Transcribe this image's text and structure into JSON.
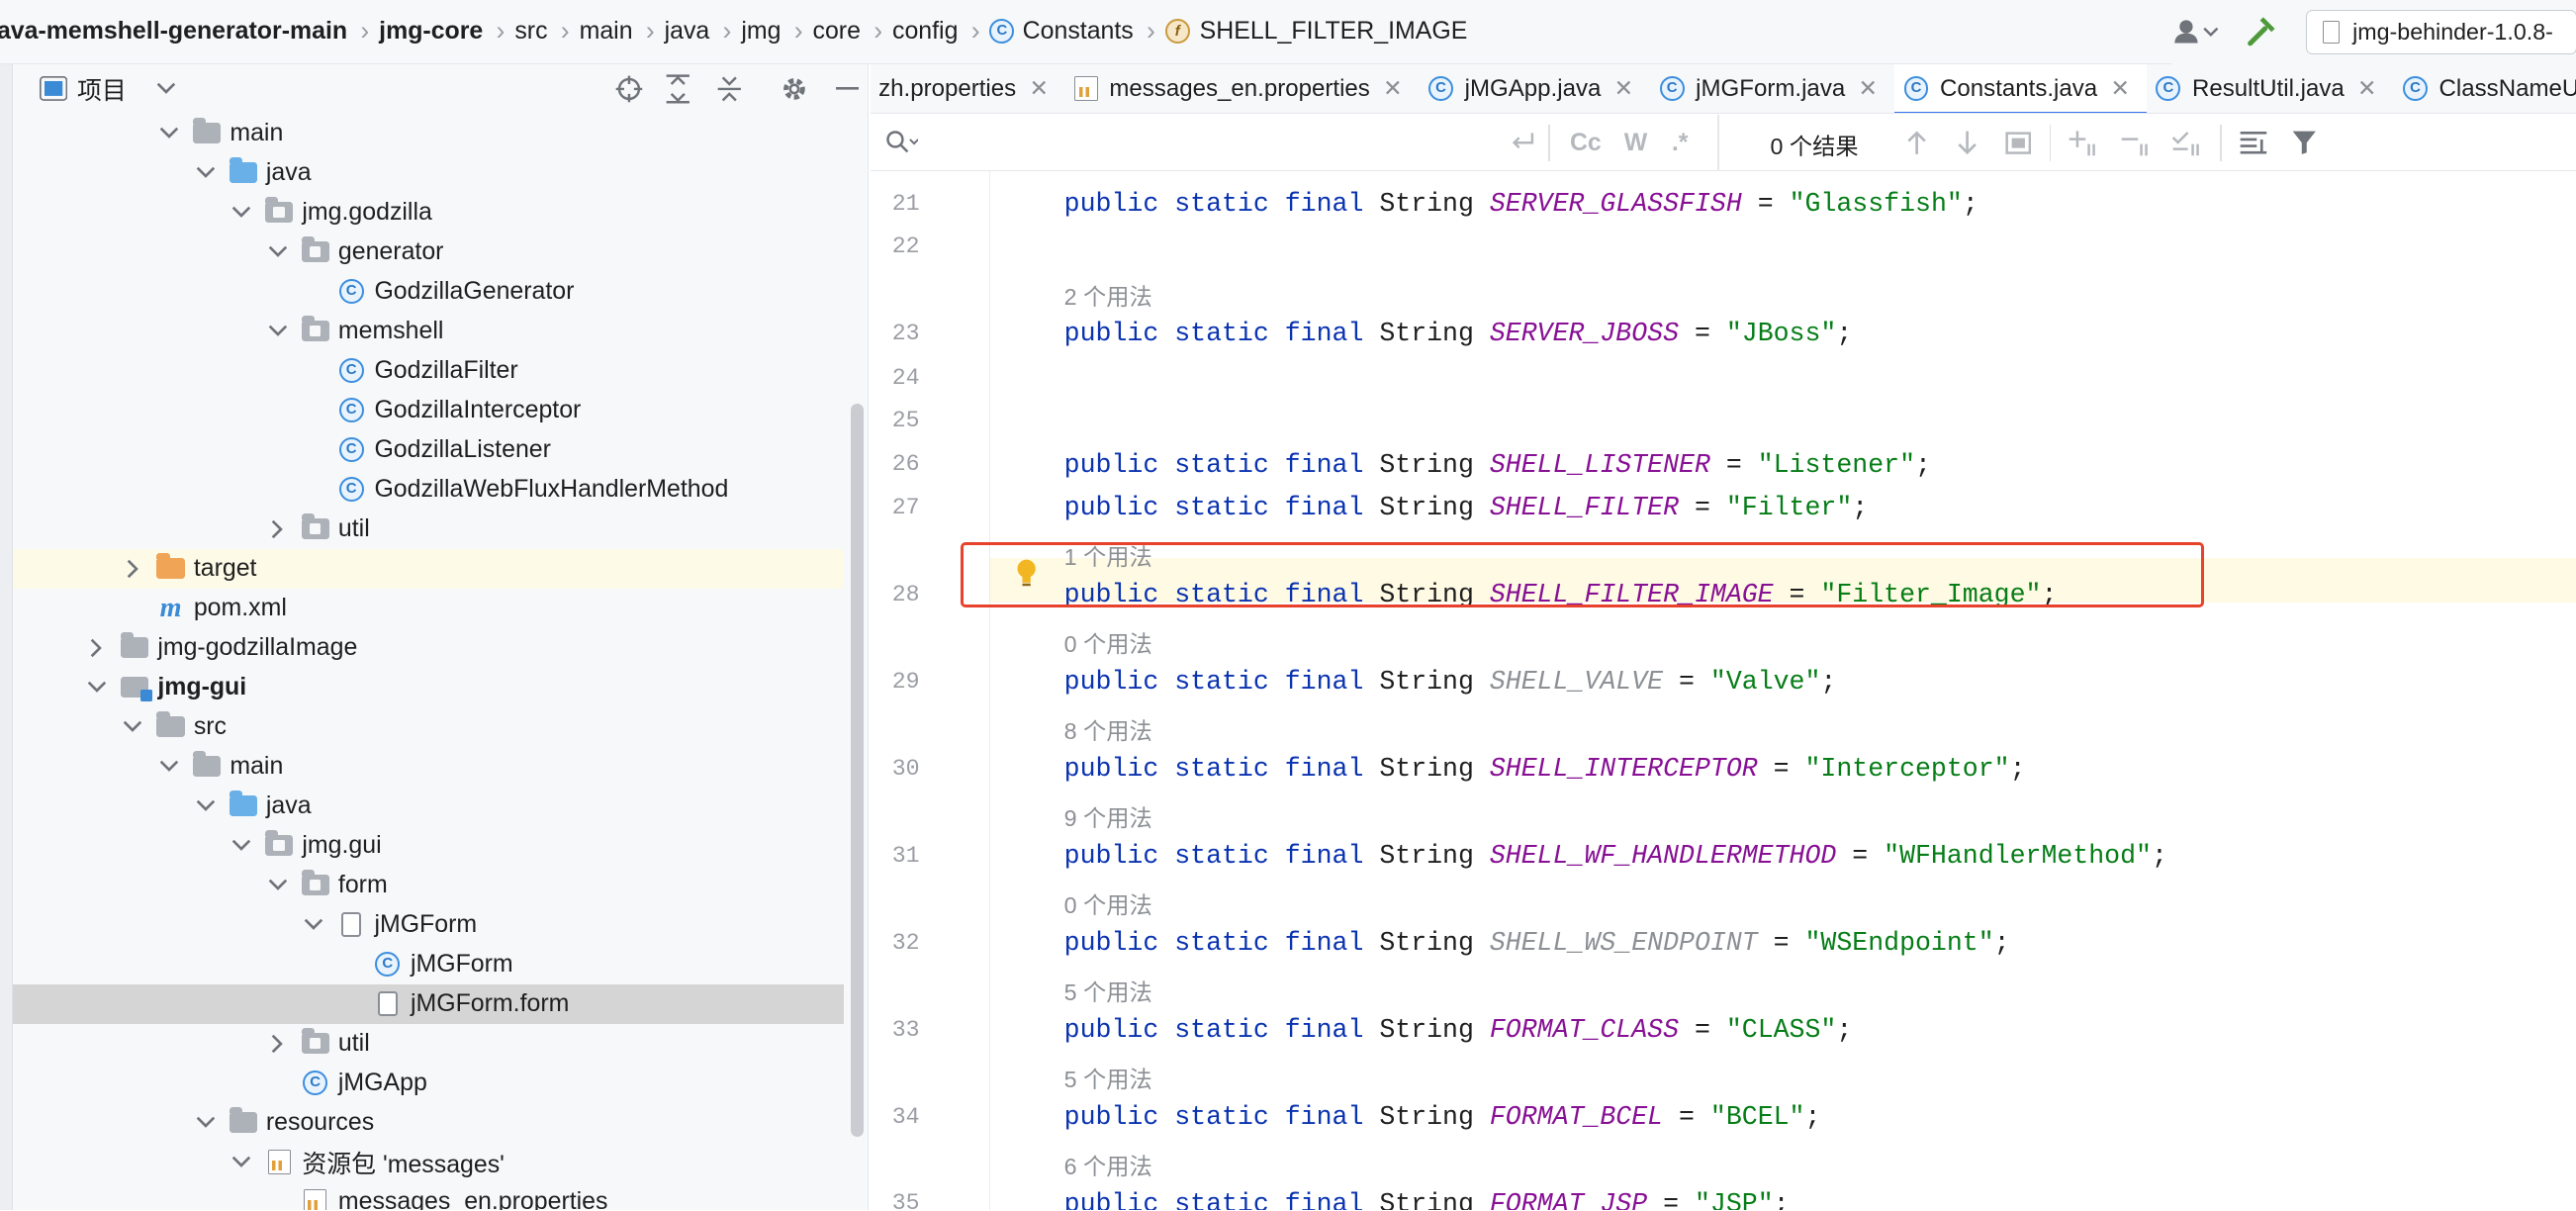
{
  "breadcrumb": {
    "items": [
      {
        "label": "java-memshell-generator-main",
        "bold": true,
        "type": "none"
      },
      {
        "label": "jmg-core",
        "bold": true,
        "type": "none"
      },
      {
        "label": "src",
        "bold": false,
        "type": "none"
      },
      {
        "label": "main",
        "bold": false,
        "type": "none"
      },
      {
        "label": "java",
        "bold": false,
        "type": "none"
      },
      {
        "label": "jmg",
        "bold": false,
        "type": "none"
      },
      {
        "label": "core",
        "bold": false,
        "type": "none"
      },
      {
        "label": "config",
        "bold": false,
        "type": "none"
      },
      {
        "label": "Constants",
        "bold": false,
        "type": "class"
      },
      {
        "label": "SHELL_FILTER_IMAGE",
        "bold": false,
        "type": "field"
      }
    ],
    "run_config": "jmg-behinder-1.0.8-"
  },
  "project": {
    "title": "项目",
    "tree": [
      {
        "indent": 3,
        "chevron": "down",
        "icon": "folder",
        "label": "main"
      },
      {
        "indent": 4,
        "chevron": "down",
        "icon": "folder-blue",
        "label": "java"
      },
      {
        "indent": 5,
        "chevron": "down",
        "icon": "package",
        "label": "jmg.godzilla"
      },
      {
        "indent": 6,
        "chevron": "down",
        "icon": "package",
        "label": "generator"
      },
      {
        "indent": 7,
        "chevron": "none",
        "icon": "class",
        "label": "GodzillaGenerator"
      },
      {
        "indent": 6,
        "chevron": "down",
        "icon": "package",
        "label": "memshell"
      },
      {
        "indent": 7,
        "chevron": "none",
        "icon": "class",
        "label": "GodzillaFilter"
      },
      {
        "indent": 7,
        "chevron": "none",
        "icon": "class",
        "label": "GodzillaInterceptor"
      },
      {
        "indent": 7,
        "chevron": "none",
        "icon": "class",
        "label": "GodzillaListener"
      },
      {
        "indent": 7,
        "chevron": "none",
        "icon": "class",
        "label": "GodzillaWebFluxHandlerMethod"
      },
      {
        "indent": 6,
        "chevron": "right",
        "icon": "package",
        "label": "util"
      },
      {
        "indent": 2,
        "chevron": "right",
        "icon": "folder-orange",
        "label": "target",
        "state": "highlight"
      },
      {
        "indent": 2,
        "chevron": "none",
        "icon": "maven",
        "label": "pom.xml"
      },
      {
        "indent": 1,
        "chevron": "right",
        "icon": "folder",
        "label": "jmg-godzillaImage"
      },
      {
        "indent": 1,
        "chevron": "down",
        "icon": "module",
        "label": "jmg-gui",
        "bold": true
      },
      {
        "indent": 2,
        "chevron": "down",
        "icon": "folder",
        "label": "src"
      },
      {
        "indent": 3,
        "chevron": "down",
        "icon": "folder",
        "label": "main"
      },
      {
        "indent": 4,
        "chevron": "down",
        "icon": "folder-blue",
        "label": "java"
      },
      {
        "indent": 5,
        "chevron": "down",
        "icon": "package",
        "label": "jmg.gui"
      },
      {
        "indent": 6,
        "chevron": "down",
        "icon": "package",
        "label": "form"
      },
      {
        "indent": 7,
        "chevron": "down",
        "icon": "form",
        "label": "jMGForm"
      },
      {
        "indent": 8,
        "chevron": "none",
        "icon": "class",
        "label": "jMGForm"
      },
      {
        "indent": 8,
        "chevron": "none",
        "icon": "form",
        "label": "jMGForm.form",
        "state": "selected"
      },
      {
        "indent": 6,
        "chevron": "right",
        "icon": "package",
        "label": "util"
      },
      {
        "indent": 6,
        "chevron": "none",
        "icon": "class-run",
        "label": "jMGApp"
      },
      {
        "indent": 4,
        "chevron": "down",
        "icon": "folder-res",
        "label": "resources"
      },
      {
        "indent": 5,
        "chevron": "down",
        "icon": "bundle",
        "label": "资源包 'messages'"
      },
      {
        "indent": 6,
        "chevron": "none",
        "icon": "properties",
        "label": "messages_en.properties"
      }
    ]
  },
  "tabs": [
    {
      "label": "zh.properties",
      "icon": "none",
      "active": false
    },
    {
      "label": "messages_en.properties",
      "icon": "properties",
      "active": false
    },
    {
      "label": "jMGApp.java",
      "icon": "class-run",
      "active": false
    },
    {
      "label": "jMGForm.java",
      "icon": "class",
      "active": false
    },
    {
      "label": "Constants.java",
      "icon": "class",
      "active": true
    },
    {
      "label": "ResultUtil.java",
      "icon": "class",
      "active": false
    },
    {
      "label": "ClassNameUt",
      "icon": "class",
      "active": false
    }
  ],
  "search": {
    "results": "0 个结果",
    "value": "",
    "case_label": "Cc",
    "word_label": "W",
    "regex_label": ".*"
  },
  "editor": {
    "lines": [
      {
        "ln": "21",
        "hint": "",
        "name": "SERVER_GLASSFISH",
        "value": "\"Glassfish\"",
        "unused": false
      },
      {
        "ln": "22",
        "hint": "2 个用法",
        "name": "",
        "value": "",
        "unused": false
      },
      {
        "ln": "23",
        "hint": "",
        "name": "SERVER_JBOSS",
        "value": "\"JBoss\"",
        "unused": false
      },
      {
        "ln": "24",
        "hint": "",
        "name": "",
        "value": "",
        "unused": false
      },
      {
        "ln": "25",
        "hint": "",
        "name": "",
        "value": "",
        "unused": false
      },
      {
        "ln": "26",
        "hint": "",
        "name": "SHELL_LISTENER",
        "value": "\"Listener\"",
        "unused": false
      },
      {
        "ln": "27",
        "hint": "1 个用法",
        "name": "SHELL_FILTER",
        "value": "\"Filter\"",
        "unused": false
      },
      {
        "ln": "28",
        "hint": "0 个用法",
        "name": "SHELL_FILTER_IMAGE",
        "value": "\"Filter_Image\"",
        "unused": false,
        "current": true
      },
      {
        "ln": "29",
        "hint": "8 个用法",
        "name": "SHELL_VALVE",
        "value": "\"Valve\"",
        "unused": true
      },
      {
        "ln": "30",
        "hint": "9 个用法",
        "name": "SHELL_INTERCEPTOR",
        "value": "\"Interceptor\"",
        "unused": false
      },
      {
        "ln": "31",
        "hint": "0 个用法",
        "name": "SHELL_WF_HANDLERMETHOD",
        "value": "\"WFHandlerMethod\"",
        "unused": false
      },
      {
        "ln": "32",
        "hint": "5 个用法",
        "name": "SHELL_WS_ENDPOINT",
        "value": "\"WSEndpoint\"",
        "unused": true
      },
      {
        "ln": "33",
        "hint": "5 个用法",
        "name": "FORMAT_CLASS",
        "value": "\"CLASS\"",
        "unused": false
      },
      {
        "ln": "34",
        "hint": "6 个用法",
        "name": "FORMAT_BCEL",
        "value": "\"BCEL\"",
        "unused": false
      },
      {
        "ln": "35",
        "hint": "",
        "name": "FORMAT_JSP",
        "value": "\"JSP\"",
        "unused": false
      }
    ],
    "keywords": {
      "public": "public",
      "static": "static",
      "final": "final",
      "type": "String"
    }
  },
  "colors": {
    "accent": "#3574f0",
    "keyword": "#0a33b1",
    "constant": "#871094",
    "string": "#067d17",
    "highlight_box": "#e8412c"
  }
}
